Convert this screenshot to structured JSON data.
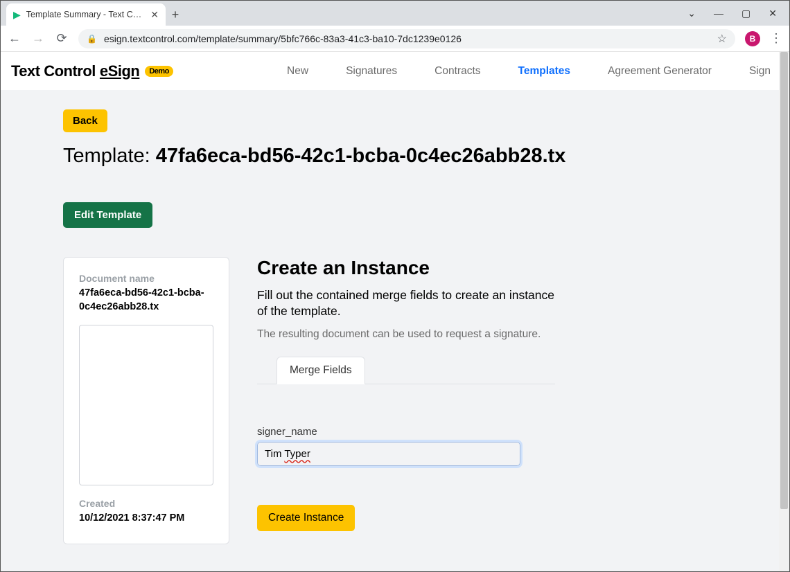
{
  "browser": {
    "tab_title": "Template Summary - Text Contro",
    "url": "esign.textcontrol.com/template/summary/5bfc766c-83a3-41c3-ba10-7dc1239e0126",
    "avatar_letter": "B"
  },
  "header": {
    "brand_prefix": "Text Control ",
    "brand_suffix": "eSign",
    "demo_badge": "Demo",
    "nav": {
      "new": "New",
      "signatures": "Signatures",
      "contracts": "Contracts",
      "templates": "Templates",
      "agreement_generator": "Agreement Generator",
      "sign": "Sign"
    },
    "active": "templates"
  },
  "page": {
    "back_label": "Back",
    "title_prefix": "Template: ",
    "title_value": "47fa6eca-bd56-42c1-bcba-0c4ec26abb28.tx",
    "edit_template_label": "Edit Template"
  },
  "doc_card": {
    "name_label": "Document name",
    "name_value": "47fa6eca-bd56-42c1-bcba-0c4ec26abb28.tx",
    "created_label": "Created",
    "created_value": "10/12/2021 8:37:47 PM"
  },
  "instance_panel": {
    "heading": "Create an Instance",
    "lead": "Fill out the contained merge fields to create an instance of the template.",
    "sub": "The resulting document can be used to request a signature.",
    "tab_label": "Merge Fields",
    "field_name": "signer_name",
    "field_value_first": "Tim ",
    "field_value_second": "Typer",
    "create_button": "Create Instance"
  }
}
